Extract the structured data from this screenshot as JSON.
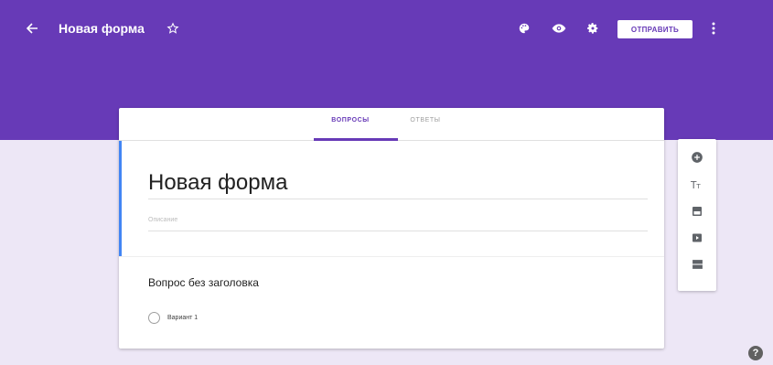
{
  "topbar": {
    "title": "Новая форма",
    "send_label": "ОТПРАВИТЬ",
    "icons": [
      "back-icon",
      "star-icon",
      "palette-icon",
      "preview-eye-icon",
      "settings-gear-icon",
      "more-vert-icon"
    ]
  },
  "tabs": [
    {
      "label": "ВОПРОСЫ",
      "active": true
    },
    {
      "label": "ОТВЕТЫ",
      "active": false
    }
  ],
  "form": {
    "title": "Новая форма",
    "description_placeholder": "Описание"
  },
  "question": {
    "title": "Вопрос без заголовка",
    "options": [
      {
        "label": "Вариант 1"
      }
    ]
  },
  "side_toolbar": {
    "icons": [
      "add-question-icon",
      "add-title-icon",
      "add-image-icon",
      "add-video-icon",
      "add-section-icon"
    ]
  },
  "colors": {
    "accent": "#673ab7",
    "background": "#ede7f6",
    "left_accent_bar": "#4285f4"
  }
}
